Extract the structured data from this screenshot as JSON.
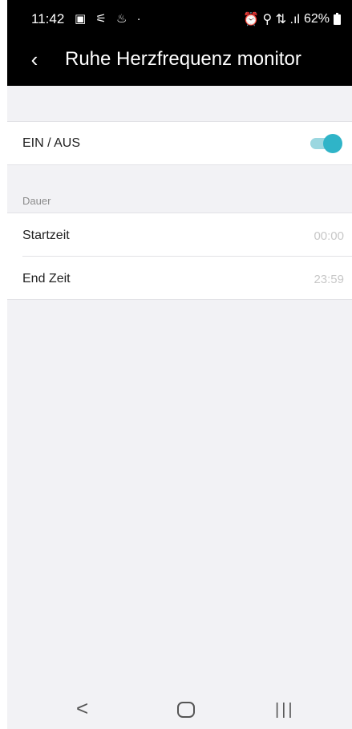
{
  "status_bar": {
    "time": "11:42",
    "left_icons": "▣ ⚟ ♨ ·",
    "right_icons": "⏰ ⚲ ⇅ .ıl",
    "battery": "62%"
  },
  "app_bar": {
    "back_glyph": "‹",
    "title": "Ruhe Herzfrequenz monitor"
  },
  "toggle_row": {
    "label": "EIN / AUS",
    "state": "on",
    "accent_color": "#2fb4c8"
  },
  "section": {
    "title": "Dauer"
  },
  "start_row": {
    "label": "Startzeit",
    "value": "00:00"
  },
  "end_row": {
    "label": "End Zeit",
    "value": "23:59"
  },
  "nav_bar": {
    "back_glyph": "<",
    "recent_glyph": "|||"
  }
}
